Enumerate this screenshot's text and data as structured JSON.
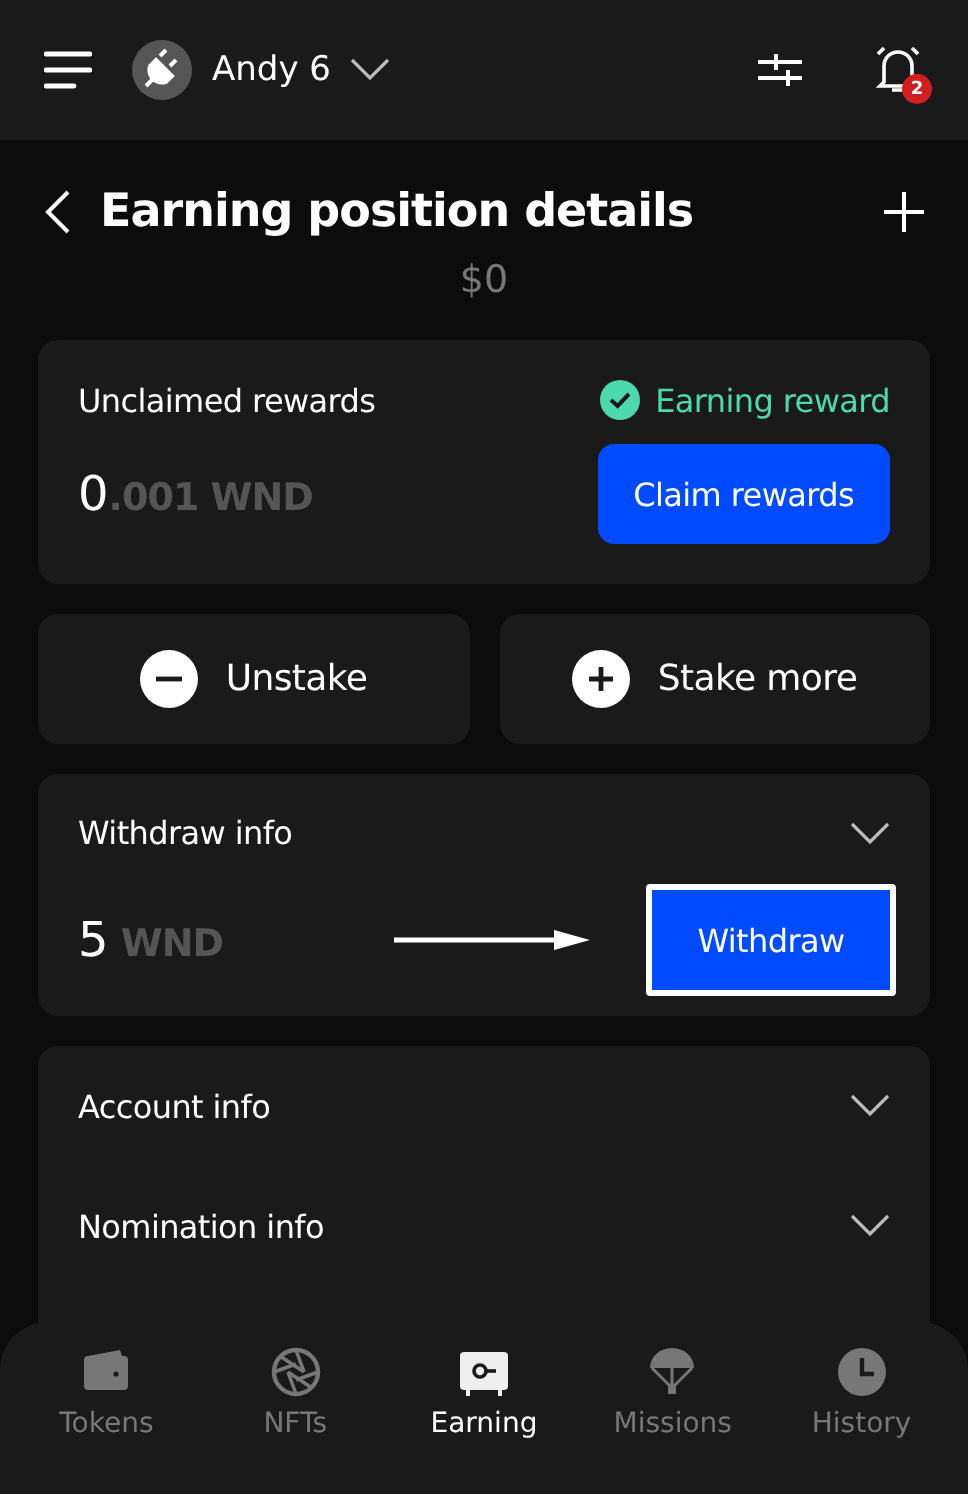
{
  "header": {
    "account_name": "Andy 6",
    "notification_count": "2"
  },
  "page": {
    "title": "Earning position details",
    "balance": "$0"
  },
  "rewards": {
    "label": "Unclaimed rewards",
    "status": "Earning reward",
    "amount_whole": "0",
    "amount_fraction": ".001",
    "symbol": "WND",
    "button": "Claim rewards"
  },
  "actions": [
    {
      "label": "Unstake",
      "kind": "minus"
    },
    {
      "label": "Stake more",
      "kind": "plus"
    }
  ],
  "withdraw": {
    "title": "Withdraw info",
    "expanded": false,
    "amount": "5",
    "symbol": "WND",
    "button": "Withdraw",
    "highlighted": true
  },
  "info_sections": [
    {
      "title": "Account info",
      "expanded": false
    },
    {
      "title": "Nomination info",
      "expanded": false
    }
  ],
  "nav": [
    {
      "label": "Tokens",
      "kind": "wallet",
      "selected": false
    },
    {
      "label": "NFTs",
      "kind": "aperture",
      "selected": false
    },
    {
      "label": "Earning",
      "kind": "safe",
      "selected": true
    },
    {
      "label": "Missions",
      "kind": "parachute",
      "selected": false
    },
    {
      "label": "History",
      "kind": "clock",
      "selected": false
    }
  ]
}
